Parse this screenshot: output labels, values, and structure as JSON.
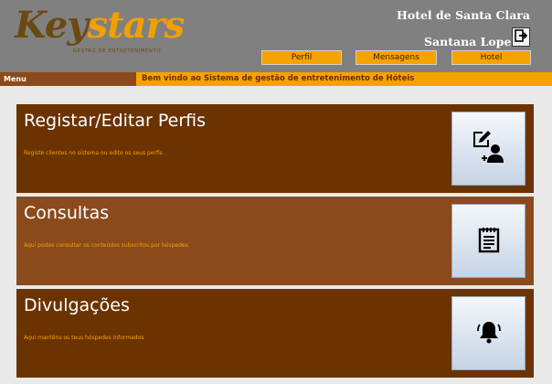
{
  "logo": {
    "key": "Key",
    "stars": "stars",
    "subtitle": "GESTÃO DE ENTRETENIMENTO"
  },
  "header": {
    "hotel_name": "Hotel de Santa Clara",
    "user_name": "Santana Lopes",
    "logout_icon": "logout-icon"
  },
  "nav": {
    "perfil": "Perfil",
    "mensagens": "Mensagens",
    "hotel": "Hotel"
  },
  "menubar": {
    "menu_label": "Menu",
    "welcome": "Bem vindo ao Sistema de gestão de entretenimento de Hóteis"
  },
  "panels": [
    {
      "title": "Registar/Editar Perfis",
      "description": "Registe clientes no sistema ou edite os seus perfis",
      "icon": "edit-add-user-icon"
    },
    {
      "title": "Consultas",
      "description": "Aqui podes consultar os conteúdos subscritos por hóspedes",
      "icon": "notepad-icon"
    },
    {
      "title": "Divulgações",
      "description": "Aqui mantêns os teus hóspedes informados",
      "icon": "bell-icon"
    }
  ],
  "colors": {
    "header_bg": "#808080",
    "accent_orange": "#f5a300",
    "panel_dark": "#6b3300",
    "panel_mid": "#8b4a1c",
    "logo_brown": "#6b4a12"
  }
}
